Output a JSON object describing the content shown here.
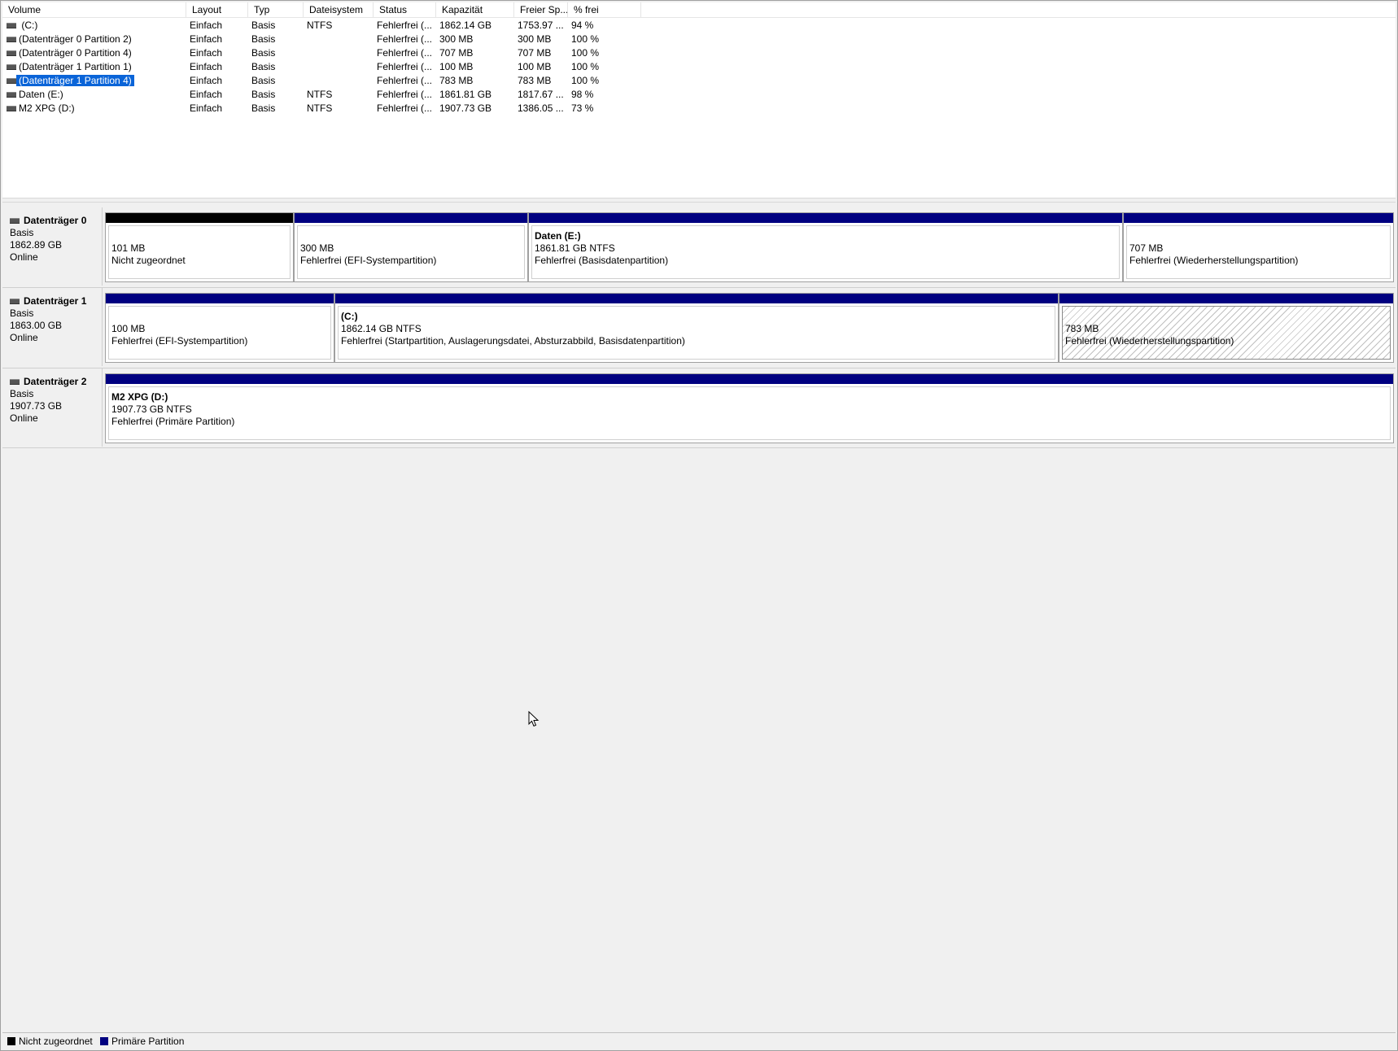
{
  "volume_list": {
    "columns": [
      "Volume",
      "Layout",
      "Typ",
      "Dateisystem",
      "Status",
      "Kapazität",
      "Freier Sp...",
      "% frei"
    ],
    "rows": [
      {
        "volume": " (C:)",
        "layout": "Einfach",
        "typ": "Basis",
        "dateisystem": "NTFS",
        "status": "Fehlerfrei (...",
        "kapazitaet": "1862.14 GB",
        "frei": "1753.97 ...",
        "prozent": "94 %"
      },
      {
        "volume": "(Datenträger 0 Partition 2)",
        "layout": "Einfach",
        "typ": "Basis",
        "dateisystem": "",
        "status": "Fehlerfrei (...",
        "kapazitaet": "300 MB",
        "frei": "300 MB",
        "prozent": "100 %"
      },
      {
        "volume": "(Datenträger 0 Partition 4)",
        "layout": "Einfach",
        "typ": "Basis",
        "dateisystem": "",
        "status": "Fehlerfrei (...",
        "kapazitaet": "707 MB",
        "frei": "707 MB",
        "prozent": "100 %"
      },
      {
        "volume": "(Datenträger 1 Partition 1)",
        "layout": "Einfach",
        "typ": "Basis",
        "dateisystem": "",
        "status": "Fehlerfrei (...",
        "kapazitaet": "100 MB",
        "frei": "100 MB",
        "prozent": "100 %"
      },
      {
        "volume": "(Datenträger 1 Partition 4)",
        "layout": "Einfach",
        "typ": "Basis",
        "dateisystem": "",
        "status": "Fehlerfrei (...",
        "kapazitaet": "783 MB",
        "frei": "783 MB",
        "prozent": "100 %",
        "selected": true
      },
      {
        "volume": "Daten (E:)",
        "layout": "Einfach",
        "typ": "Basis",
        "dateisystem": "NTFS",
        "status": "Fehlerfrei (...",
        "kapazitaet": "1861.81 GB",
        "frei": "1817.67 ...",
        "prozent": "98 %"
      },
      {
        "volume": "M2 XPG (D:)",
        "layout": "Einfach",
        "typ": "Basis",
        "dateisystem": "NTFS",
        "status": "Fehlerfrei (...",
        "kapazitaet": "1907.73 GB",
        "frei": "1386.05 ...",
        "prozent": "73 %"
      }
    ]
  },
  "disks": [
    {
      "title": "Datenträger 0",
      "type": "Basis",
      "size": "1862.89 GB",
      "state": "Online",
      "partitions": [
        {
          "name": "",
          "size": "101 MB",
          "status": "Nicht zugeordnet",
          "kind": "unallocated"
        },
        {
          "name": "",
          "size": "300 MB",
          "status": "Fehlerfrei (EFI-Systempartition)",
          "kind": "primary"
        },
        {
          "name": "Daten  (E:)",
          "size": "1861.81 GB NTFS",
          "status": "Fehlerfrei (Basisdatenpartition)",
          "kind": "primary"
        },
        {
          "name": "",
          "size": "707 MB",
          "status": "Fehlerfrei (Wiederherstellungspartition)",
          "kind": "primary"
        }
      ]
    },
    {
      "title": "Datenträger 1",
      "type": "Basis",
      "size": "1863.00 GB",
      "state": "Online",
      "partitions": [
        {
          "name": "",
          "size": "100 MB",
          "status": "Fehlerfrei (EFI-Systempartition)",
          "kind": "primary"
        },
        {
          "name": " (C:)",
          "size": "1862.14 GB NTFS",
          "status": "Fehlerfrei (Startpartition, Auslagerungsdatei, Absturzabbild, Basisdatenpartition)",
          "kind": "primary"
        },
        {
          "name": "",
          "size": "783 MB",
          "status": "Fehlerfrei (Wiederherstellungspartition)",
          "kind": "primary",
          "selected": true
        }
      ]
    },
    {
      "title": "Datenträger 2",
      "type": "Basis",
      "size": "1907.73 GB",
      "state": "Online",
      "partitions": [
        {
          "name": "M2 XPG  (D:)",
          "size": "1907.73 GB NTFS",
          "status": "Fehlerfrei (Primäre Partition)",
          "kind": "primary"
        }
      ]
    }
  ],
  "legend": [
    {
      "label": "Nicht zugeordnet",
      "color": "#000000"
    },
    {
      "label": "Primäre Partition",
      "color": "#000080"
    }
  ],
  "colors": {
    "primary": "#000080",
    "unallocated": "#000000",
    "selection": "#0a64d8"
  }
}
